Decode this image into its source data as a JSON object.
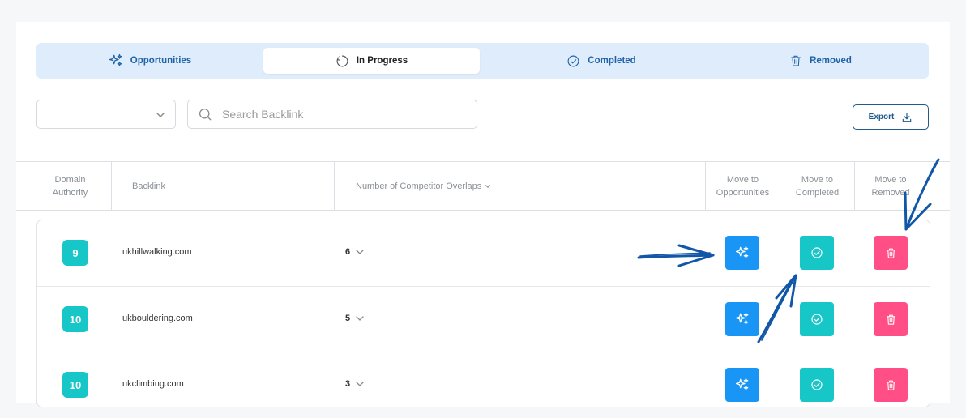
{
  "tabs": [
    {
      "label": "Opportunities",
      "icon": "sparkles-icon"
    },
    {
      "label": "In Progress",
      "icon": "progress-icon",
      "active": true
    },
    {
      "label": "Completed",
      "icon": "check-circle-icon"
    },
    {
      "label": "Removed",
      "icon": "trash-icon"
    }
  ],
  "filters": {
    "select_value": "",
    "search_placeholder": "Search Backlink",
    "export_label": "Export"
  },
  "table": {
    "headers": {
      "domain_authority": [
        "Domain",
        "Authority"
      ],
      "backlink": "Backlink",
      "overlaps": "Number of Competitor Overlaps",
      "move_opportunities": [
        "Move to",
        "Opportunities"
      ],
      "move_completed": [
        "Move to",
        "Completed"
      ],
      "move_removed": [
        "Move to",
        "Removed"
      ]
    },
    "rows": [
      {
        "da": "9",
        "backlink": "ukhillwalking.com",
        "overlaps": "6"
      },
      {
        "da": "10",
        "backlink": "ukbouldering.com",
        "overlaps": "5"
      },
      {
        "da": "10",
        "backlink": "ukclimbing.com",
        "overlaps": "3"
      }
    ]
  },
  "colors": {
    "accent_blue": "#1996f5",
    "teal": "#17c6c6",
    "pink": "#ff4f86",
    "tab_bar_bg": "#dfecfb",
    "annotation_arrows": "#1256a8"
  }
}
